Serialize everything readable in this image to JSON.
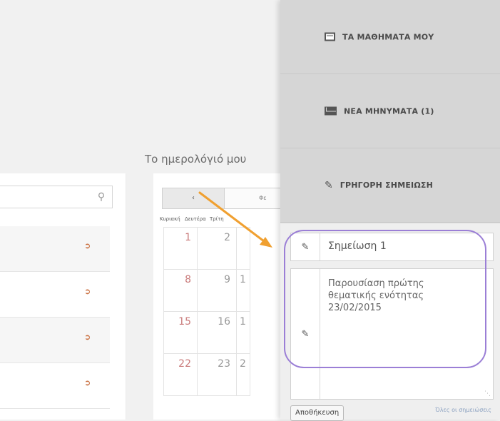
{
  "calendar": {
    "title": "Το ημερολόγιό μου",
    "prev_label": "‹",
    "month_label": "Φε",
    "day_names": [
      "Κυριακή",
      "Δευτέρα",
      "Τρίτη"
    ],
    "weeks": [
      [
        "1",
        "2"
      ],
      [
        "8",
        "9"
      ],
      [
        "15",
        "16"
      ],
      [
        "22",
        "23"
      ]
    ],
    "partial_third_col": [
      "",
      "1",
      "1",
      "2"
    ]
  },
  "sidebar": {
    "items": [
      {
        "icon": "calendar-icon",
        "label": "ΤΑ ΜΑΘΗΜΑΤΑ ΜΟΥ"
      },
      {
        "icon": "envelope-icon",
        "label": "ΝΕΑ ΜΗΝΥΜΑΤΑ (1)"
      },
      {
        "icon": "pencil-icon",
        "label": "ΓΡΗΓΟΡΗ ΣΗΜΕΙΩΣΗ"
      }
    ]
  },
  "quick_note": {
    "title_value": "Σημείωση 1",
    "body_value": "Παρουσίαση πρώτης\nθεματικής ενότητας\n23/02/2015",
    "save_label": "Αποθήκευση",
    "all_notes_label": "Όλες οι σημειώσεις"
  },
  "colors": {
    "accent_arrow": "#f0a030",
    "highlight": "#9b7fd6",
    "sunday": "#c97a7a"
  }
}
